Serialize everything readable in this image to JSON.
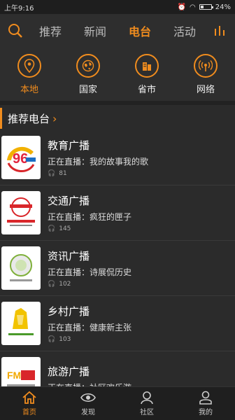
{
  "status": {
    "time": "上午9:16",
    "battery": "24%"
  },
  "tabs": [
    {
      "label": "推荐"
    },
    {
      "label": "新闻"
    },
    {
      "label": "电台"
    },
    {
      "label": "活动"
    }
  ],
  "categories": [
    {
      "label": "本地",
      "icon": "location-icon"
    },
    {
      "label": "国家",
      "icon": "globe-icon"
    },
    {
      "label": "省市",
      "icon": "building-icon"
    },
    {
      "label": "网络",
      "icon": "broadcast-icon"
    }
  ],
  "section": {
    "title": "推荐电台"
  },
  "stations": [
    {
      "name": "教育广播",
      "now_label": "正在直播：我的故事我的歌",
      "listeners": "81",
      "logo_color": "#e2233d"
    },
    {
      "name": "交通广播",
      "now_label": "正在直播：疯狂的匣子",
      "listeners": "145",
      "logo_color": "#d9262a"
    },
    {
      "name": "资讯广播",
      "now_label": "正在直播：诗展侃历史",
      "listeners": "102",
      "logo_color": "#7fb03b"
    },
    {
      "name": "乡村广播",
      "now_label": "正在直播：健康新主张",
      "listeners": "103",
      "logo_color": "#f2c300"
    },
    {
      "name": "旅游广播",
      "now_label": "正在直播：社区欢乐游",
      "listeners": "",
      "logo_color": "#f2a900"
    }
  ],
  "bottom_nav": [
    {
      "label": "首页"
    },
    {
      "label": "发现"
    },
    {
      "label": "社区"
    },
    {
      "label": "我的"
    }
  ],
  "colors": {
    "accent": "#f08c1e",
    "background": "#2b2b2b"
  }
}
